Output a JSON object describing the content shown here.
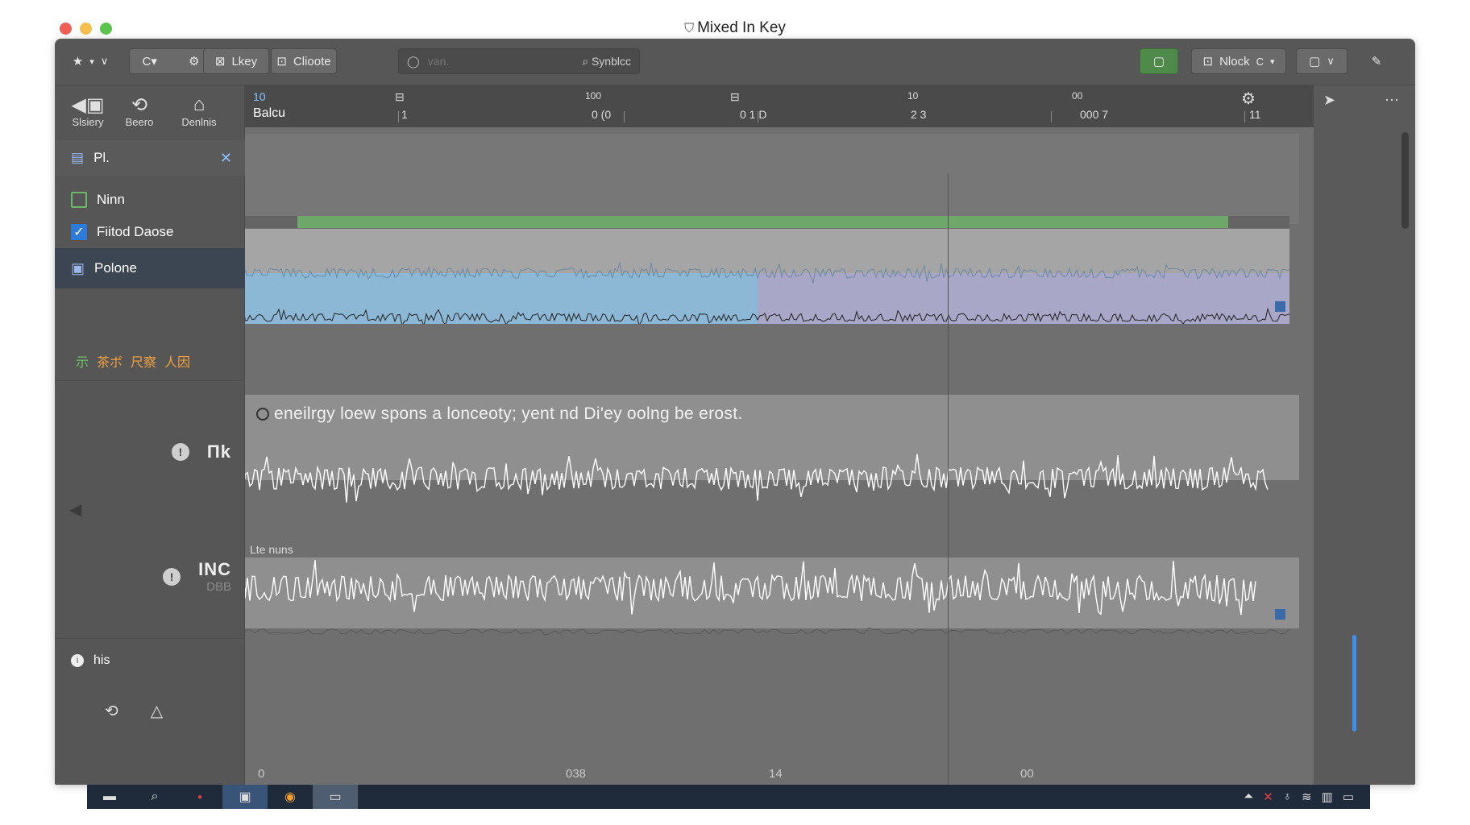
{
  "window": {
    "title": "Mixed In Key",
    "title_icon": "key-shield-icon"
  },
  "toolbar": {
    "btn_library": "Lkey",
    "btn_choose": "Clioote",
    "search_placeholder": "van.",
    "search_mode": "Synblcc",
    "btn_mark": "Nlock",
    "btn_mark_suffix": "C"
  },
  "nav": {
    "items": [
      {
        "label": "Slsiery",
        "icon": "library-icon"
      },
      {
        "label": "Beero",
        "icon": "sync-icon"
      },
      {
        "label": "Denlnis",
        "icon": "home-icon"
      }
    ]
  },
  "panel": {
    "title": "Pl.",
    "rows": [
      {
        "label": "Ninn",
        "checked": false
      },
      {
        "label": "Fiitod Daose",
        "checked": true
      },
      {
        "label": "Polone",
        "selected": true
      }
    ],
    "key_badges": [
      {
        "text": "示",
        "color": "#6fc06a"
      },
      {
        "text": "茶ボ",
        "color": "#f0a040"
      },
      {
        "text": "尺察",
        "color": "#f0a040"
      },
      {
        "text": "人因",
        "color": "#f0a040"
      }
    ]
  },
  "tracks": [
    {
      "name": "Πk",
      "sub": ""
    },
    {
      "name": "INC",
      "sub": "DBB"
    }
  ],
  "footer_item": {
    "label": "his"
  },
  "ruler": {
    "track_label": "Balcu",
    "markers": [
      {
        "top": "10",
        "bottom": ""
      },
      {
        "top": "",
        "bottom": "1"
      },
      {
        "top": "100",
        "bottom": "0 (0"
      },
      {
        "top": "",
        "bottom": "0 1 D"
      },
      {
        "top": "10",
        "bottom": "2 3"
      },
      {
        "top": "00",
        "bottom": "000 7"
      },
      {
        "top": "",
        "bottom": "11"
      }
    ]
  },
  "lanes": {
    "caption": "eneilrgy loew spons a lonceoty; yent nd Di'ey oolng be erost.",
    "lane3_label": "Lte nuns"
  },
  "bottom_axis": [
    "0",
    "038",
    "14",
    "00"
  ],
  "colors": {
    "accent_blue": "#8cb8d6",
    "accent_lilac": "#a9a7c8",
    "progress_green": "#6fa66a"
  }
}
